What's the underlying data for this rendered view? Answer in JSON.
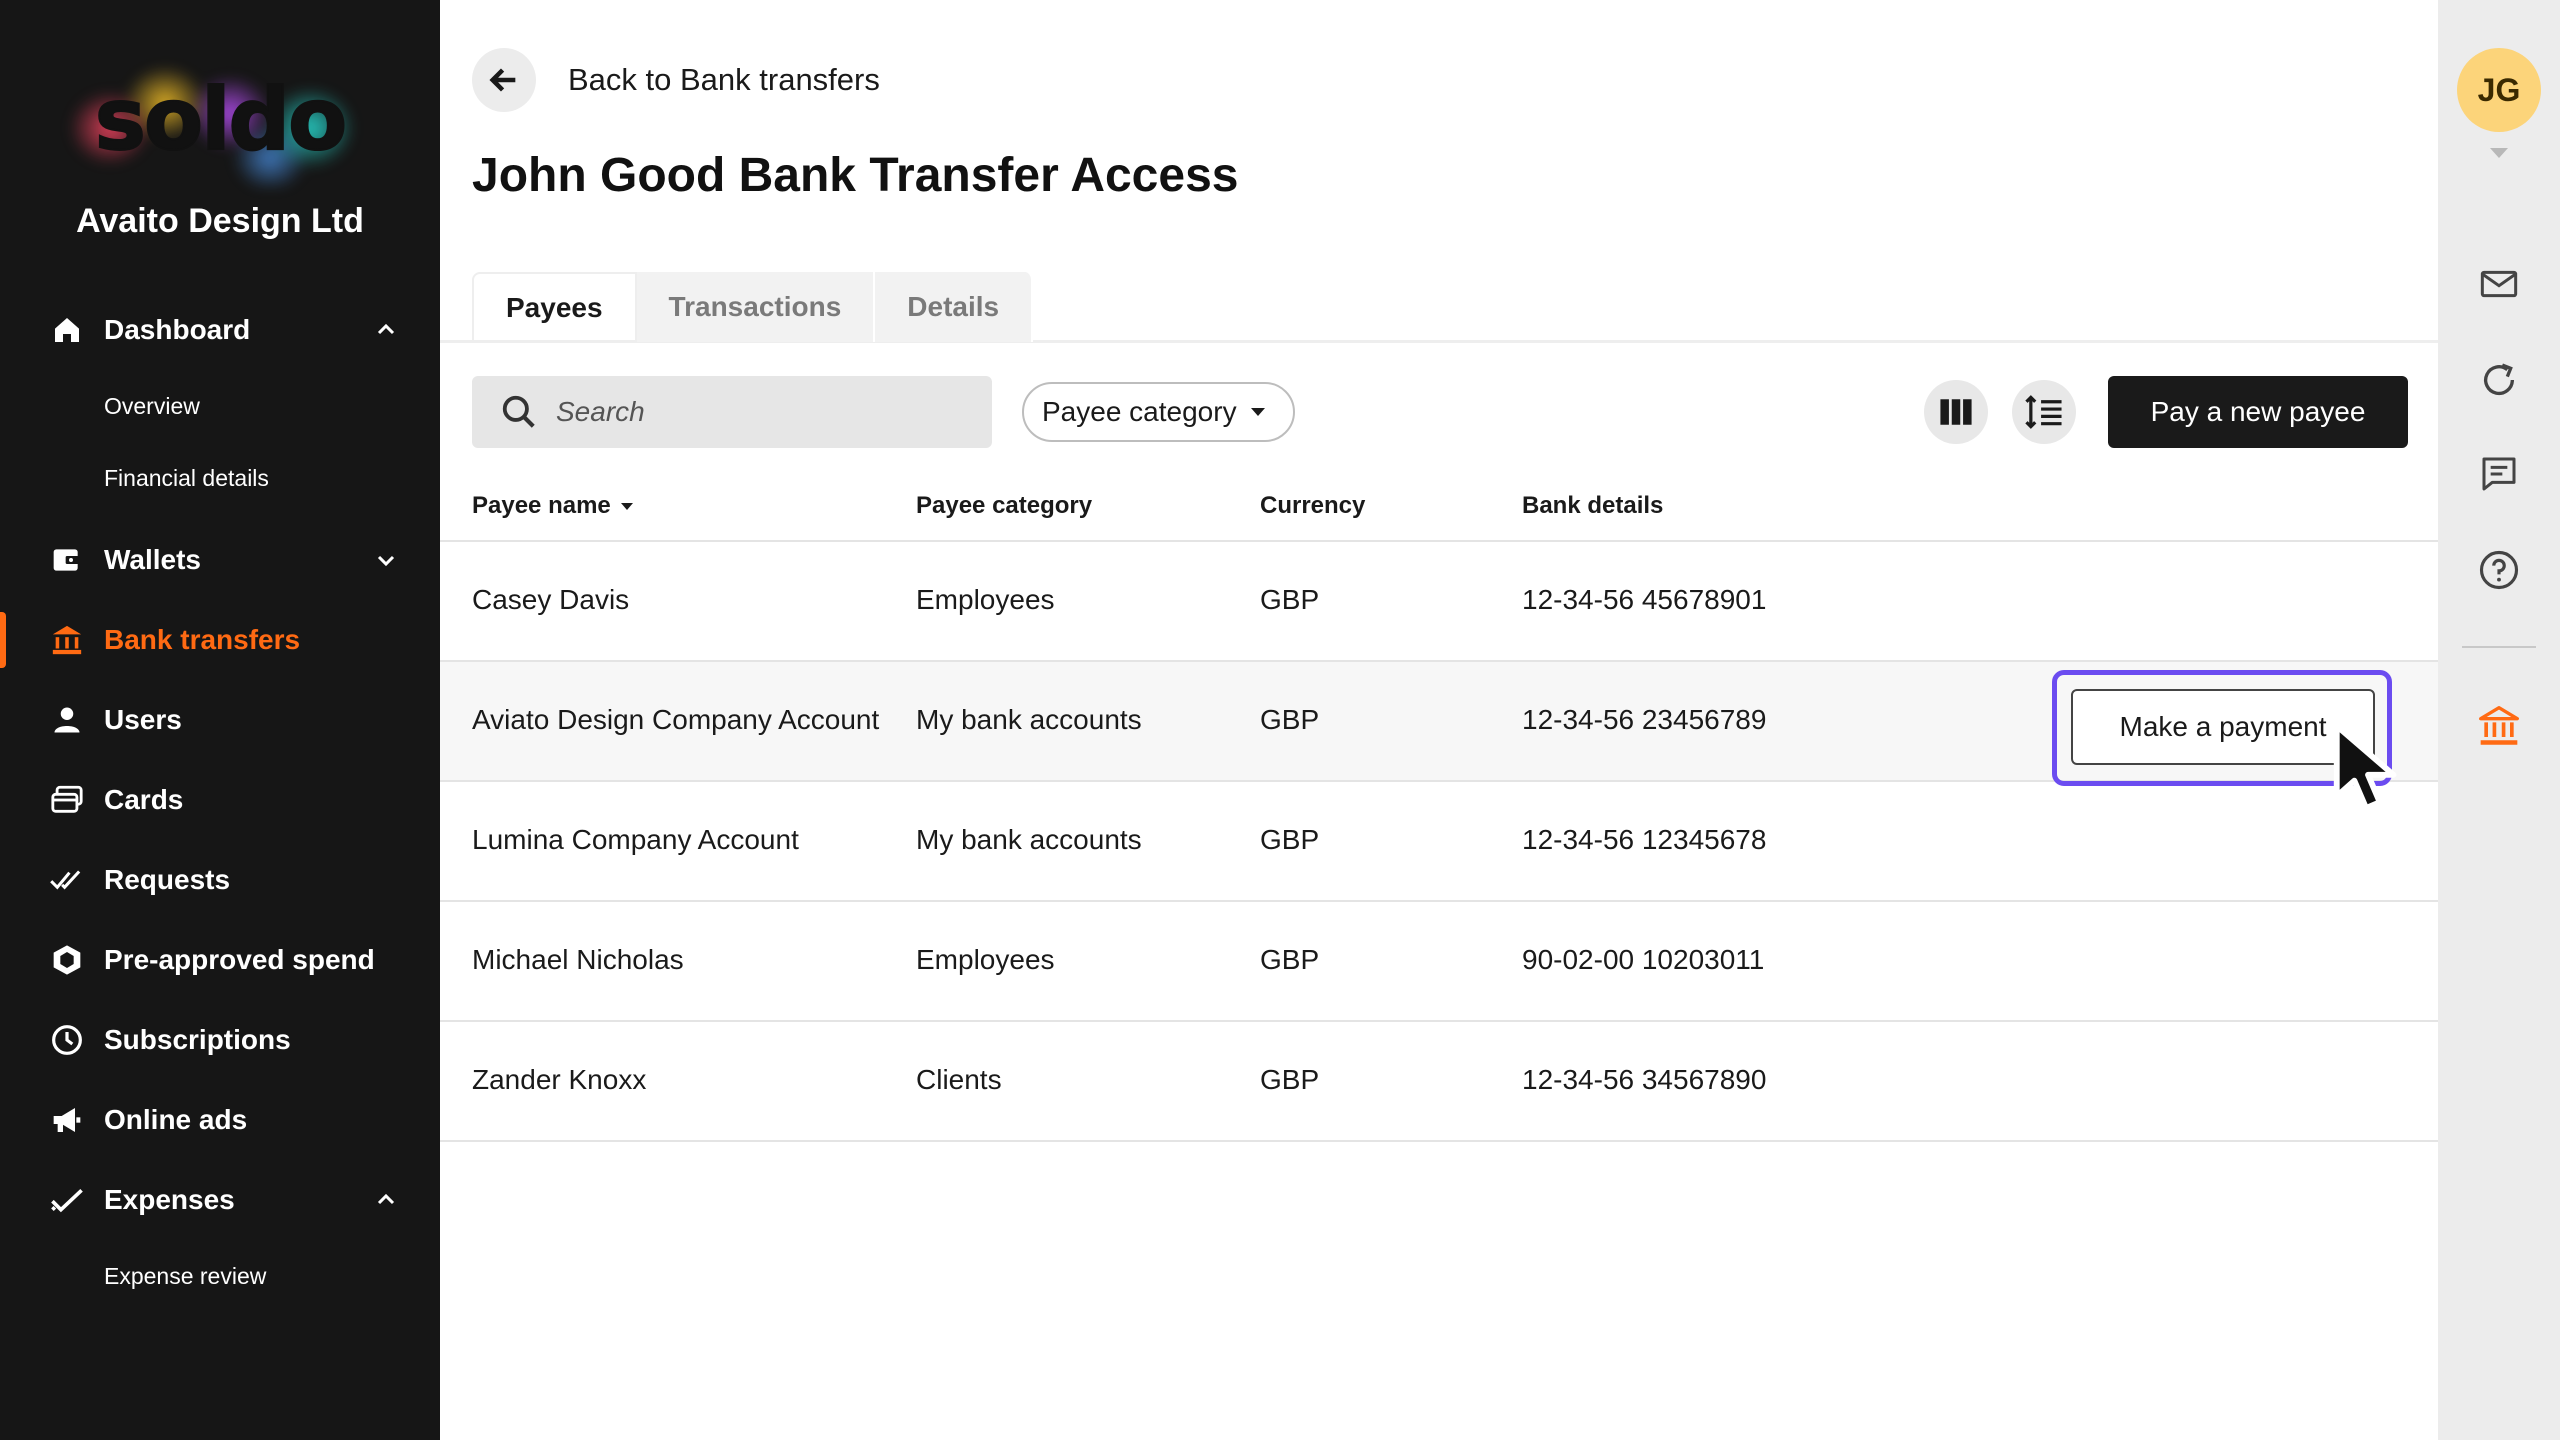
{
  "sidebar": {
    "logo_text": "soldo",
    "company": "Avaito Design Ltd",
    "nav": {
      "dashboard": "Dashboard",
      "overview": "Overview",
      "financial_details": "Financial details",
      "wallets": "Wallets",
      "bank_transfers": "Bank transfers",
      "users": "Users",
      "cards": "Cards",
      "requests": "Requests",
      "pre_approved_spend": "Pre-approved spend",
      "subscriptions": "Subscriptions",
      "online_ads": "Online ads",
      "expenses": "Expenses",
      "expense_review": "Expense review"
    },
    "active_item": "Bank transfers",
    "accent_color": "#ff6a13"
  },
  "header": {
    "back_label": "Back to Bank transfers",
    "title": "John Good Bank Transfer Access"
  },
  "tabs": [
    {
      "label": "Payees",
      "active": true
    },
    {
      "label": "Transactions",
      "active": false
    },
    {
      "label": "Details",
      "active": false
    }
  ],
  "toolbar": {
    "search_placeholder": "Search",
    "filter_label": "Payee category",
    "columns_icon": "columns-icon",
    "density_icon": "line-height-icon",
    "primary_label": "Pay a new payee"
  },
  "table": {
    "headers": {
      "payee_name": "Payee name",
      "payee_category": "Payee category",
      "currency": "Currency",
      "bank_details": "Bank details"
    },
    "rows": [
      {
        "name": "Casey Davis",
        "category": "Employees",
        "currency": "GBP",
        "bank": "12-34-56 45678901"
      },
      {
        "name": "Aviato Design Company Account",
        "category": "My bank accounts",
        "currency": "GBP",
        "bank": "12-34-56 23456789"
      },
      {
        "name": "Lumina Company Account",
        "category": "My bank accounts",
        "currency": "GBP",
        "bank": "12-34-56 12345678"
      },
      {
        "name": "Michael Nicholas",
        "category": "Employees",
        "currency": "GBP",
        "bank": "90-02-00 10203011"
      },
      {
        "name": "Zander Knoxx",
        "category": "Clients",
        "currency": "GBP",
        "bank": "12-34-56 34567890"
      }
    ],
    "row_action_label": "Make a payment",
    "highlight_color": "#6b4cf0"
  },
  "rail": {
    "avatar_initials": "JG",
    "avatar_color": "#fcd47a",
    "icons": [
      "mail-icon",
      "refresh-icon",
      "chat-icon",
      "help-icon",
      "bank-icon"
    ]
  }
}
